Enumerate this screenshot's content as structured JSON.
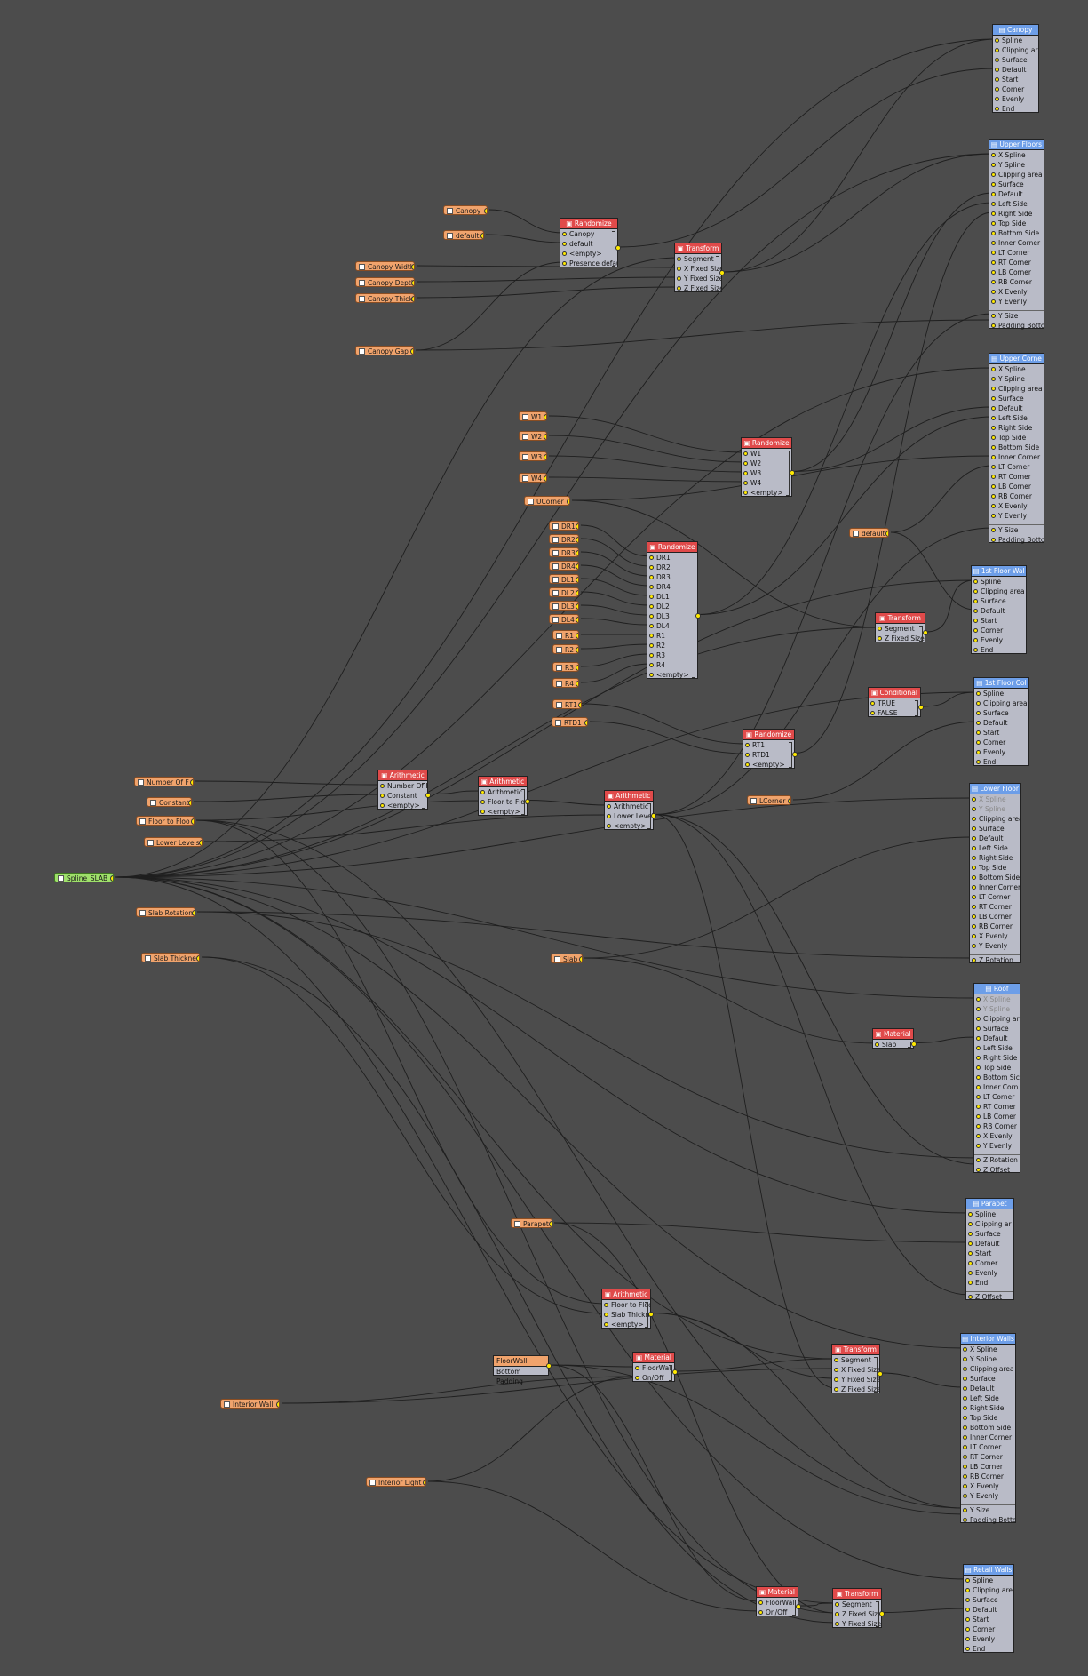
{
  "inputs": {
    "canopy": "Canopy",
    "default_a": "default",
    "canopy_width": "Canopy Width",
    "canopy_depth": "Canopy Depth",
    "canopy_thick": "Canopy Thick",
    "canopy_gap": "Canopy Gap",
    "w1": "W1",
    "w2": "W2",
    "w3": "W3",
    "w4": "W4",
    "lcorner_u": "UCorner",
    "dr1": "DR1",
    "dr2": "DR2",
    "dr3": "DR3",
    "dr4": "DR4",
    "dl1": "DL1",
    "dl2": "DL2",
    "dl3": "DL3",
    "dl4": "DL4",
    "r1": "R1",
    "r2": "R2",
    "r3": "R3",
    "r4": "R4",
    "rt1": "RT1",
    "rtd1": "RTD1",
    "default_b": "default",
    "lcorner": "LCorner",
    "number_of_floors": "Number Of F",
    "constant": "Constant",
    "floor_to_floor": "Floor to Floo",
    "lower_levels": "Lower Levels",
    "spline_slab": "Spline_SLAB",
    "slab_rotation": "Slab Rotation",
    "slab_thickness": "Slab Thickne",
    "slab": "Slab",
    "parapet": "Parapet",
    "floorwall": "FloorWall",
    "floorwall_sub": "Bottom Padding",
    "interior_wall": "Interior Wall",
    "interior_light": "Interior Light"
  },
  "ops": {
    "rand1": {
      "title": "Randomize",
      "rows": [
        "Canopy",
        "default",
        "<empty>",
        "Presence default"
      ]
    },
    "transform1": {
      "title": "Transform",
      "rows": [
        "Segment",
        "X Fixed Size",
        "Y Fixed Size",
        "Z Fixed Size"
      ]
    },
    "rand2": {
      "title": "Randomize",
      "rows": [
        "W1",
        "W2",
        "W3",
        "W4",
        "<empty>"
      ]
    },
    "rand3": {
      "title": "Randomize",
      "rows": [
        "DR1",
        "DR2",
        "DR3",
        "DR4",
        "DL1",
        "DL2",
        "DL3",
        "DL4",
        "R1",
        "R2",
        "R3",
        "R4",
        "<empty>"
      ]
    },
    "transform2": {
      "title": "Transform",
      "rows": [
        "Segment",
        "Z Fixed Size"
      ]
    },
    "conditional": {
      "title": "Conditional",
      "rows": [
        "TRUE",
        "FALSE"
      ]
    },
    "rand4": {
      "title": "Randomize",
      "rows": [
        "RT1",
        "RTD1",
        "<empty>"
      ]
    },
    "arith1": {
      "title": "Arithmetic",
      "rows": [
        "Number Of Fl",
        "Constant",
        "<empty>"
      ]
    },
    "arith2": {
      "title": "Arithmetic",
      "rows": [
        "Arithmetic",
        "Floor to Floor",
        "<empty>"
      ]
    },
    "arith3": {
      "title": "Arithmetic",
      "rows": [
        "Arithmetic",
        "Lower Levels",
        "<empty>"
      ]
    },
    "material1": {
      "title": "Material",
      "rows": [
        "Slab"
      ]
    },
    "arith4": {
      "title": "Arithmetic",
      "rows": [
        "Floor to Floor",
        "Slab Thickness",
        "<empty>"
      ]
    },
    "material2": {
      "title": "Material",
      "rows": [
        "FloorWall",
        "On/Off"
      ]
    },
    "transform3": {
      "title": "Transform",
      "rows": [
        "Segment",
        "X Fixed Size",
        "Y Fixed Size",
        "Z Fixed Size"
      ]
    },
    "material3": {
      "title": "Material",
      "rows": [
        "FloorWall",
        "On/Off"
      ]
    },
    "transform4": {
      "title": "Transform",
      "rows": [
        "Segment",
        "Z Fixed Size",
        "Y Fixed Size"
      ]
    }
  },
  "outputs": {
    "canopy": {
      "title": "Canopy",
      "rows": [
        "Spline",
        "Clipping ar",
        "Surface",
        "Default",
        "Start",
        "Corner",
        "Evenly",
        "End"
      ]
    },
    "upper_floors": {
      "title": "Upper Floors",
      "rows": [
        "X Spline",
        "Y Spline",
        "Clipping area",
        "Surface",
        "Default",
        "Left Side",
        "Right Side",
        "Top Side",
        "Bottom Side",
        "Inner Corner",
        "LT Corner",
        "RT Corner",
        "LB Corner",
        "RB Corner",
        "X Evenly",
        "Y Evenly"
      ],
      "extra": [
        "Y Size",
        "Padding Bottom"
      ]
    },
    "upper_corner": {
      "title": "Upper Corne",
      "rows": [
        "X Spline",
        "Y Spline",
        "Clipping area",
        "Surface",
        "Default",
        "Left Side",
        "Right Side",
        "Top Side",
        "Bottom Side",
        "Inner Corner",
        "LT Corner",
        "RT Corner",
        "LB Corner",
        "RB Corner",
        "X Evenly",
        "Y Evenly"
      ],
      "extra": [
        "Y Size",
        "Padding Bottom"
      ]
    },
    "first_floor_wall": {
      "title": "1st Floor Wal",
      "rows": [
        "Spline",
        "Clipping area",
        "Surface",
        "Default",
        "Start",
        "Corner",
        "Evenly",
        "End"
      ]
    },
    "first_floor_col": {
      "title": "1st Floor Col",
      "rows": [
        "Spline",
        "Clipping area",
        "Surface",
        "Default",
        "Start",
        "Corner",
        "Evenly",
        "End"
      ]
    },
    "lower_floor": {
      "title": "Lower Floor",
      "rows": [
        "X Spline",
        "Y Spline",
        "Clipping area",
        "Surface",
        "Default",
        "Left Side",
        "Right Side",
        "Top Side",
        "Bottom Side",
        "Inner Corner",
        "LT Corner",
        "RT Corner",
        "LB Corner",
        "RB Corner",
        "X Evenly",
        "Y Evenly"
      ],
      "extra": [
        "Z Rotation"
      ]
    },
    "roof": {
      "title": "Roof",
      "rows": [
        "X Spline",
        "Y Spline",
        "Clipping ar",
        "Surface",
        "Default",
        "Left Side",
        "Right Side",
        "Top Side",
        "Bottom Sic",
        "Inner Corn",
        "LT Corner",
        "RT Corner",
        "LB Corner",
        "RB Corner",
        "X Evenly",
        "Y Evenly"
      ],
      "extra": [
        "Z Rotation",
        "Z Offset"
      ]
    },
    "parapet": {
      "title": "Parapet",
      "rows": [
        "Spline",
        "Clipping ar",
        "Surface",
        "Default",
        "Start",
        "Corner",
        "Evenly",
        "End"
      ],
      "extra": [
        "Z Offset"
      ]
    },
    "interior_walls": {
      "title": "Interior Walls",
      "rows": [
        "X Spline",
        "Y Spline",
        "Clipping area",
        "Surface",
        "Default",
        "Left Side",
        "Right Side",
        "Top Side",
        "Bottom Side",
        "Inner Corner",
        "LT Corner",
        "RT Corner",
        "LB Corner",
        "RB Corner",
        "X Evenly",
        "Y Evenly"
      ],
      "extra": [
        "Y Size",
        "Padding Bottom"
      ]
    },
    "retail_walls": {
      "title": "Retail Walls",
      "rows": [
        "Spline",
        "Clipping area",
        "Surface",
        "Default",
        "Start",
        "Corner",
        "Evenly",
        "End"
      ]
    }
  },
  "colors": {
    "background": "#4c4c4c",
    "input_pill": "#f0a36c",
    "spline_pill": "#9ee06a",
    "operator_header": "#e04a4a",
    "output_header": "#6d9ee8",
    "node_body": "#b9bbc7",
    "wire": "#1f1f1f",
    "socket": "#ffea00"
  }
}
